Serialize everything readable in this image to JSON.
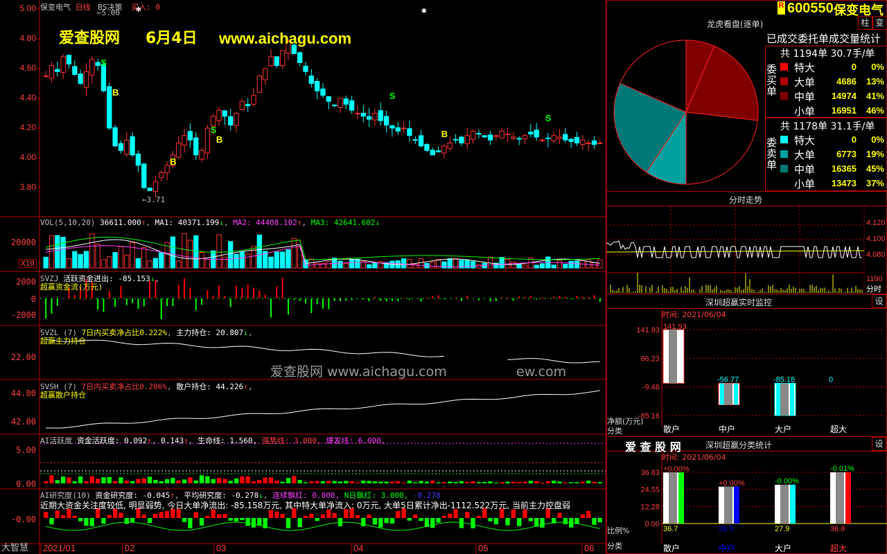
{
  "stock": {
    "code": "600550",
    "name": "保变电气",
    "badge": "R",
    "header_name": "保变电气",
    "period": "日线",
    "bs_label": "BS决策",
    "bs_value": "买入: 0"
  },
  "promo": {
    "site_cn": "爱查股网",
    "date": "6月4日",
    "site_url": "www.aichagu.com"
  },
  "watermark": {
    "text": "爱查股网 www.aichagu.com",
    "trail": "ew.com"
  },
  "price_axis": {
    "ticks": [
      "5.00",
      "4.80",
      "4.60",
      "4.40",
      "4.20",
      "4.00",
      "3.80"
    ],
    "high_marker": "5.00",
    "low_marker": "3.71"
  },
  "volume": {
    "title": "VOL(5,10,20)",
    "val": "36611.000",
    "ma1": "MA1: 40371.199",
    "ma2": "MA2: 44408.102",
    "ma3": "MA3: 42641.602",
    "tick": "20000",
    "unit": "X10"
  },
  "svzj": {
    "title": "SVZJ",
    "desc": "活跃资金进出: -85.153",
    "sub": "超赢资金流(万元)",
    "ticks": [
      "2000",
      "0",
      "-2000"
    ]
  },
  "svzl": {
    "title": "SVZL (7)",
    "desc": "7日内买卖净占比0.222%",
    "hold": "主力持仓: 20.807",
    "sub": "超赢主力持仓",
    "tick": "22.00"
  },
  "svsh": {
    "title": "SVSH (7)",
    "desc": "7日内买卖净占比0.206%",
    "hold": "散户持仓: 44.226",
    "sub": "超赢散户持仓",
    "ticks": [
      "44.00",
      "42.00"
    ]
  },
  "ai_act": {
    "title": "AI活跃度",
    "a": "资金活跃度: 0.092",
    "b": "0.143",
    "c": "生命线: 1.560,",
    "d": "强势线: 3.000,",
    "e": "爆发线: 6.000,",
    "ticks": [
      "5.00",
      "0.00"
    ]
  },
  "ai_res": {
    "title": "AI研究度(10)",
    "a": "资金研究度: -0.045",
    "b": "平均研究度: -0.278",
    "c": "连续飘红: 0.000,",
    "d": "N日飘红: 3.000,",
    "e": "-0.278",
    "comment": "近期大资金关注度较低, 明显弱势, 今日大单净流出: -85.158万元, 其中特大单净流入: 0万元, 大单5日累计净出-1112.522万元, 当前主力控盘弱",
    "tick": "-0.00"
  },
  "brand": "大智慧",
  "xaxis": [
    "2021/01",
    "02",
    "03",
    "04",
    "05",
    "06"
  ],
  "right": {
    "btn_zhu": "柱",
    "btn_bian": "变",
    "dragon_title": "龙虎看盘(逐单)",
    "dragon_sub": "已成交委托单成交量统计",
    "buy_side": "委买单",
    "sell_side": "委卖单",
    "buy_total": "共 1194单 30.7手/单",
    "sell_total": "共 1178单 31.1手/单",
    "buy_rows": [
      {
        "label": "特大",
        "val": "0",
        "pct": "0%",
        "color": "#ff0000"
      },
      {
        "label": "大单",
        "val": "4686",
        "pct": "13%",
        "color": "#b40000"
      },
      {
        "label": "中单",
        "val": "14974",
        "pct": "41%",
        "color": "#800000"
      },
      {
        "label": "小单",
        "val": "16951",
        "pct": "46%",
        "color": "#000000"
      }
    ],
    "sell_rows": [
      {
        "label": "特大",
        "val": "0",
        "pct": "0%",
        "color": "#00ffff"
      },
      {
        "label": "大单",
        "val": "6773",
        "pct": "19%",
        "color": "#00a0a0"
      },
      {
        "label": "中单",
        "val": "16365",
        "pct": "45%",
        "color": "#007878"
      },
      {
        "label": "小单",
        "val": "13473",
        "pct": "37%",
        "color": "#000000"
      }
    ],
    "intraday_title": "分时走势",
    "intraday_ticks": [
      "4.120",
      "4.100",
      "4.080"
    ],
    "intraday_vol": "1190",
    "intraday_unit": "分时",
    "monitor_title": "深圳超赢实时监控",
    "monitor_btn": "设",
    "monitor_time": "时间: 2021/06/04",
    "monitor_yticks": [
      "141.93",
      "66.23",
      "-9.46",
      "-85.16"
    ],
    "monitor_ylabel": "净额(万元)",
    "monitor_xlabel": "分类",
    "monitor_values": [
      "141.93",
      "-56.77",
      "-85.16",
      "0"
    ],
    "categories": [
      "散户",
      "中户",
      "大户",
      "超大"
    ],
    "stat_brand": "爱 查 股 网",
    "stat_title": "深圳超赢分类统计",
    "stat_btn": "设",
    "stat_time": "时间: 2021/06/04",
    "stat_yticks": [
      "36.83",
      "24.55",
      "12.28",
      "0.00"
    ],
    "stat_ylabel": "比例%",
    "stat_xlabel": "分类",
    "stat_top": [
      "+0.00%",
      "+0.00%",
      "-0.00%",
      "-0.01%"
    ],
    "stat_bottom": [
      "36.7",
      "26.5",
      "27.9",
      "36.8"
    ]
  },
  "chart_data": [
    {
      "type": "bar",
      "title": "深圳超赢实时监控",
      "ylabel": "净额(万元)",
      "categories": [
        "散户",
        "中户",
        "大户",
        "超大"
      ],
      "values": [
        141.93,
        -56.77,
        -85.16,
        0
      ],
      "ylim": [
        -85.16,
        141.93
      ]
    },
    {
      "type": "bar",
      "title": "深圳超赢分类统计",
      "ylabel": "比例%",
      "categories": [
        "散户",
        "中户",
        "大户",
        "超大"
      ],
      "values": [
        36.7,
        26.5,
        27.9,
        36.8
      ],
      "ylim": [
        0,
        36.83
      ]
    },
    {
      "type": "pie",
      "title": "龙虎看盘(逐单)",
      "categories": [
        "委买大单",
        "委买中单",
        "委买小单",
        "委卖大单",
        "委卖中单",
        "委卖小单"
      ],
      "values": [
        4686,
        14974,
        16951,
        6773,
        16365,
        13473
      ]
    }
  ]
}
